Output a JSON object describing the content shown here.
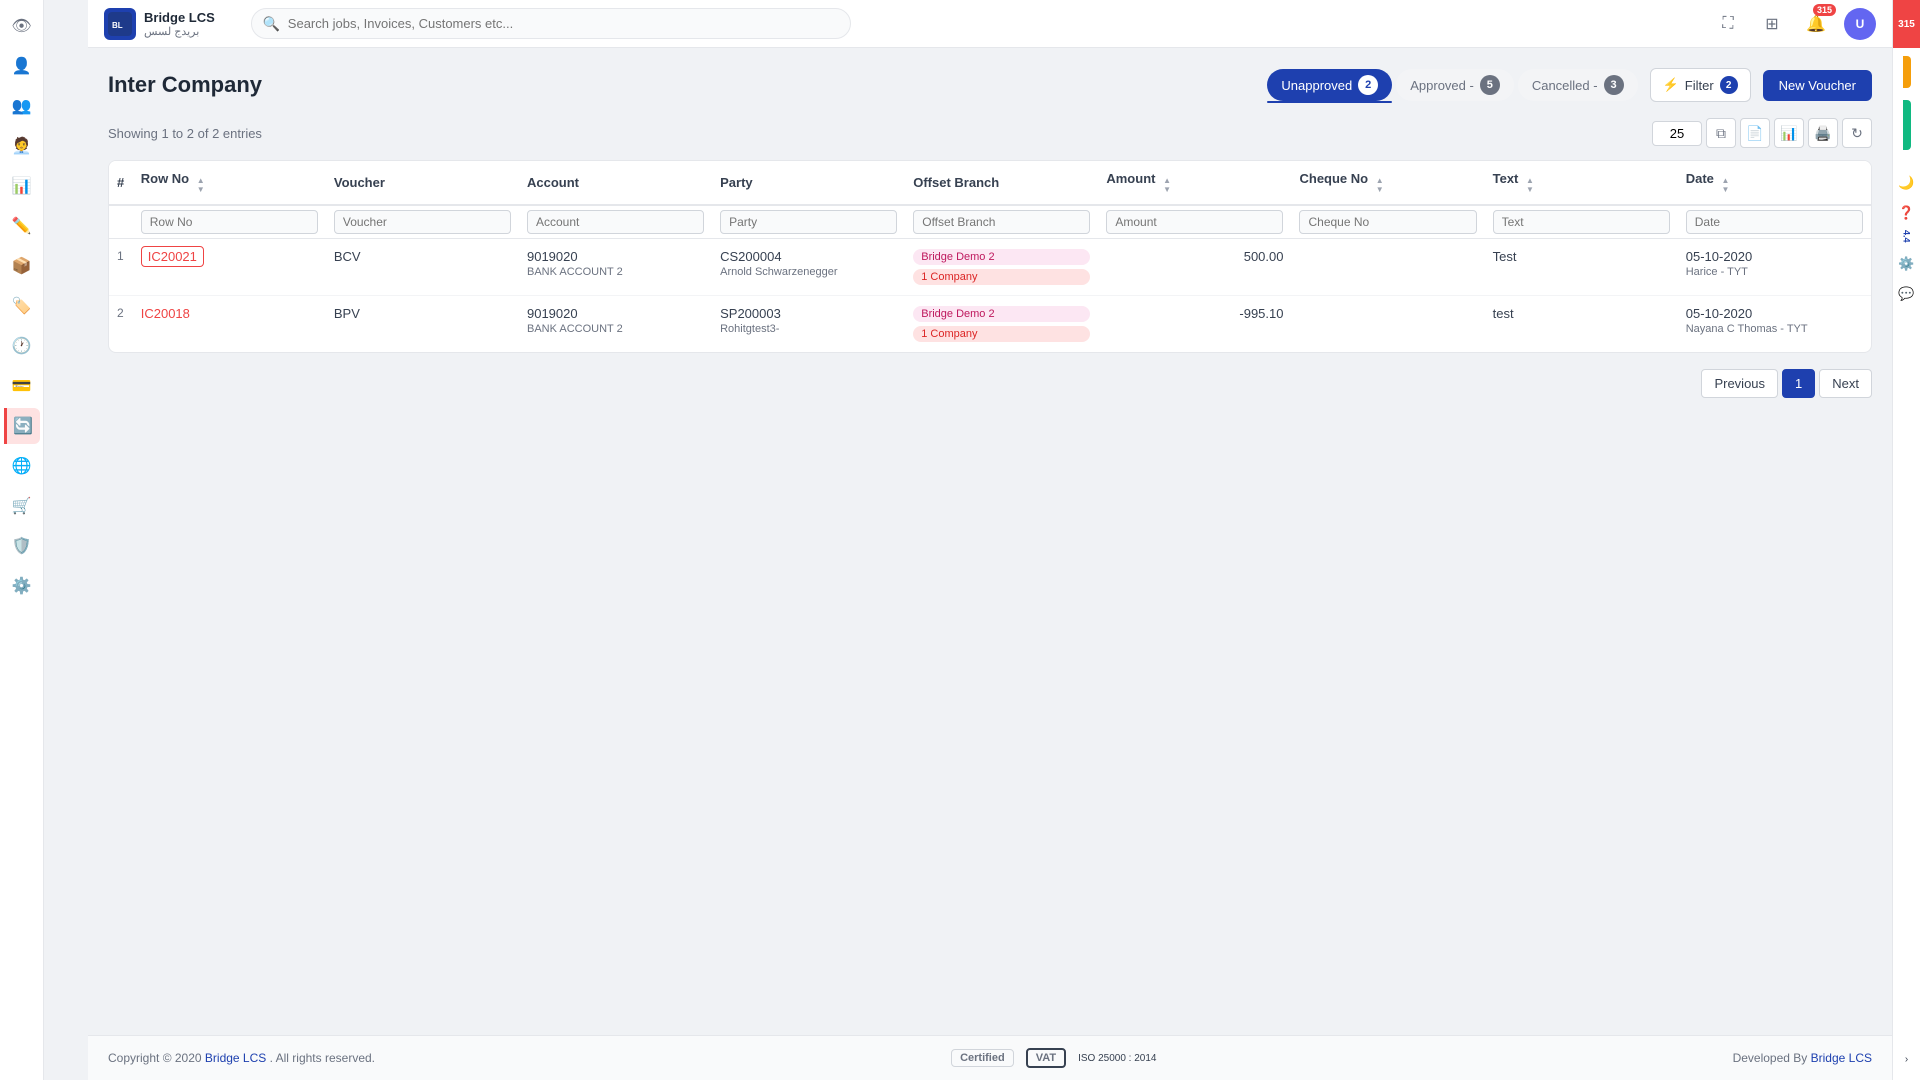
{
  "app": {
    "logo_text": "BL",
    "company_name": "Bridge LCS",
    "company_arabic": "بريدج لسس"
  },
  "topnav": {
    "search_placeholder": "Search jobs, Invoices, Customers etc...",
    "notification_count": "315",
    "version_label": "4.4"
  },
  "page": {
    "title": "Inter Company",
    "showing_text": "Showing 1 to 2 of 2 entries",
    "per_page": "25"
  },
  "tabs": [
    {
      "label": "Unapproved",
      "count": "2",
      "active": true
    },
    {
      "label": "Approved -",
      "count": "5",
      "active": false
    },
    {
      "label": "Cancelled -",
      "count": "3",
      "active": false
    }
  ],
  "filter": {
    "label": "Filter",
    "count": "2"
  },
  "buttons": {
    "new_voucher": "New Voucher",
    "previous": "Previous",
    "next": "Next"
  },
  "table": {
    "columns": [
      "#",
      "Row No",
      "Voucher",
      "Account",
      "Party",
      "Offset Branch",
      "Amount",
      "Cheque No",
      "Text",
      "Date"
    ],
    "filters": [
      "Row No",
      "Voucher",
      "Account",
      "Party",
      "Offset Branch",
      "Amount",
      "Cheque No",
      "Text",
      "Date"
    ],
    "rows": [
      {
        "num": "1",
        "row_no": "IC20021",
        "voucher": "BCV",
        "account": "9019020",
        "account_sub": "BANK ACCOUNT 2",
        "party_code": "CS200004",
        "party_name": "Arnold Schwarzenegger",
        "offset_branch1": "Bridge Demo 2",
        "offset_branch2": "1 Company",
        "amount": "500.00",
        "cheque_no": "",
        "text": "Test",
        "date": "05-10-2020",
        "date_sub": "Harice - TYT"
      },
      {
        "num": "2",
        "row_no": "IC20018",
        "voucher": "BPV",
        "account": "9019020",
        "account_sub": "BANK ACCOUNT 2",
        "party_code": "SP200003",
        "party_name": "Rohitgtest3-",
        "offset_branch1": "Bridge Demo 2",
        "offset_branch2": "1 Company",
        "amount": "-995.10",
        "cheque_no": "",
        "text": "test",
        "date": "05-10-2020",
        "date_sub": "Nayana C Thomas - TYT"
      }
    ]
  },
  "footer": {
    "copyright": "Copyright © 2020",
    "company_link": "Bridge LCS",
    "rights": ". All rights reserved.",
    "developed_by": "Developed By",
    "dev_link": "Bridge LCS",
    "certified_label": "Certified",
    "vat_label": "VAT",
    "iso_label": "ISO 25000 : 2014"
  },
  "sidebar": {
    "icons": [
      {
        "name": "eye-icon",
        "symbol": "👁"
      },
      {
        "name": "user-icon",
        "symbol": "👤"
      },
      {
        "name": "users-icon",
        "symbol": "👥"
      },
      {
        "name": "user-plus-icon",
        "symbol": "🧑‍💼"
      },
      {
        "name": "chart-icon",
        "symbol": "📊"
      },
      {
        "name": "edit-icon",
        "symbol": "✏️"
      },
      {
        "name": "box-icon",
        "symbol": "📦"
      },
      {
        "name": "tag-icon",
        "symbol": "🏷️"
      },
      {
        "name": "clock-icon",
        "symbol": "🕐"
      },
      {
        "name": "card-icon",
        "symbol": "💳"
      },
      {
        "name": "refresh-icon",
        "symbol": "🔄"
      },
      {
        "name": "globe-icon",
        "symbol": "🌐"
      },
      {
        "name": "cart-icon",
        "symbol": "🛒"
      },
      {
        "name": "shield-icon",
        "symbol": "🛡️"
      },
      {
        "name": "settings-icon",
        "symbol": "⚙️"
      }
    ]
  }
}
